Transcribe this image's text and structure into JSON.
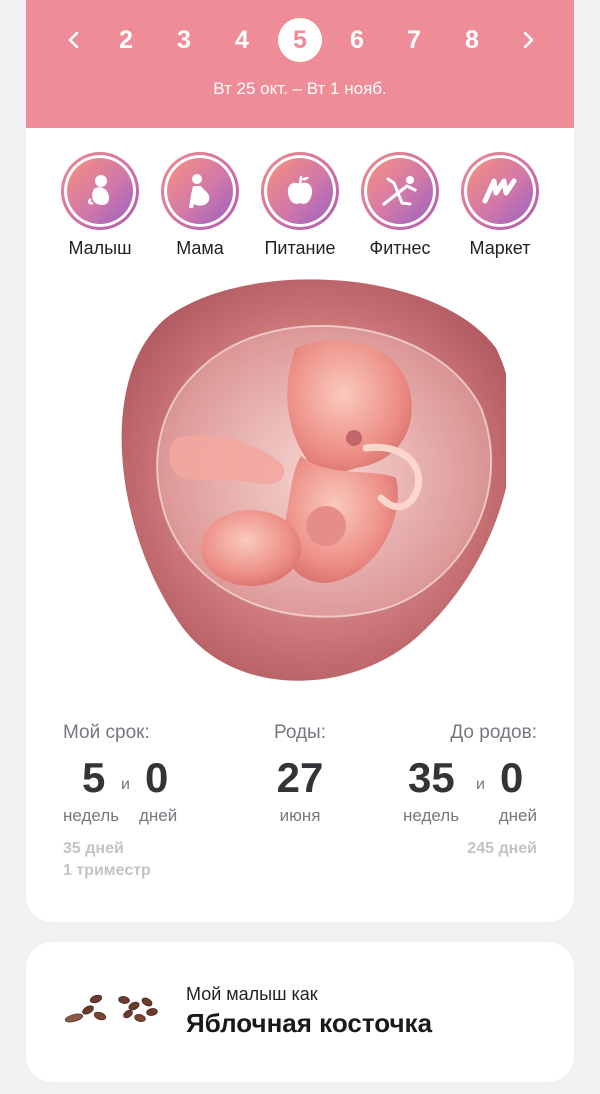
{
  "week_nav": {
    "prev_icon": "chevron-left-icon",
    "next_icon": "chevron-right-icon",
    "weeks": [
      "2",
      "3",
      "4",
      "5",
      "6",
      "7",
      "8"
    ],
    "selected": "5",
    "date_range": "Вт 25 окт. – Вт 1 нояб."
  },
  "categories": [
    {
      "label": "Малыш",
      "icon": "baby-icon"
    },
    {
      "label": "Мама",
      "icon": "mother-icon"
    },
    {
      "label": "Питание",
      "icon": "apple-icon"
    },
    {
      "label": "Фитнес",
      "icon": "yoga-icon"
    },
    {
      "label": "Маркет",
      "icon": "market-logo-icon"
    }
  ],
  "stats": {
    "term": {
      "label": "Мой срок:",
      "weeks": "5",
      "and": "и",
      "days": "0",
      "weeks_unit": "недель",
      "days_unit": "дней",
      "total_days": "35 дней",
      "trimester": "1 триместр"
    },
    "birth": {
      "label": "Роды:",
      "day": "27",
      "month": "июня"
    },
    "remaining": {
      "label": "До родов:",
      "weeks": "35",
      "and": "и",
      "days": "0",
      "weeks_unit": "недель",
      "days_unit": "дней",
      "total_days": "245 дней"
    }
  },
  "fruit": {
    "subtitle": "Мой малыш как",
    "name": "Яблочная косточка",
    "icon": "apple-seeds-icon"
  },
  "colors": {
    "header": "#ee8c98",
    "accent_gradient_start": "#f08c86",
    "accent_gradient_end": "#9c62c0",
    "background": "#f1f1f3"
  }
}
